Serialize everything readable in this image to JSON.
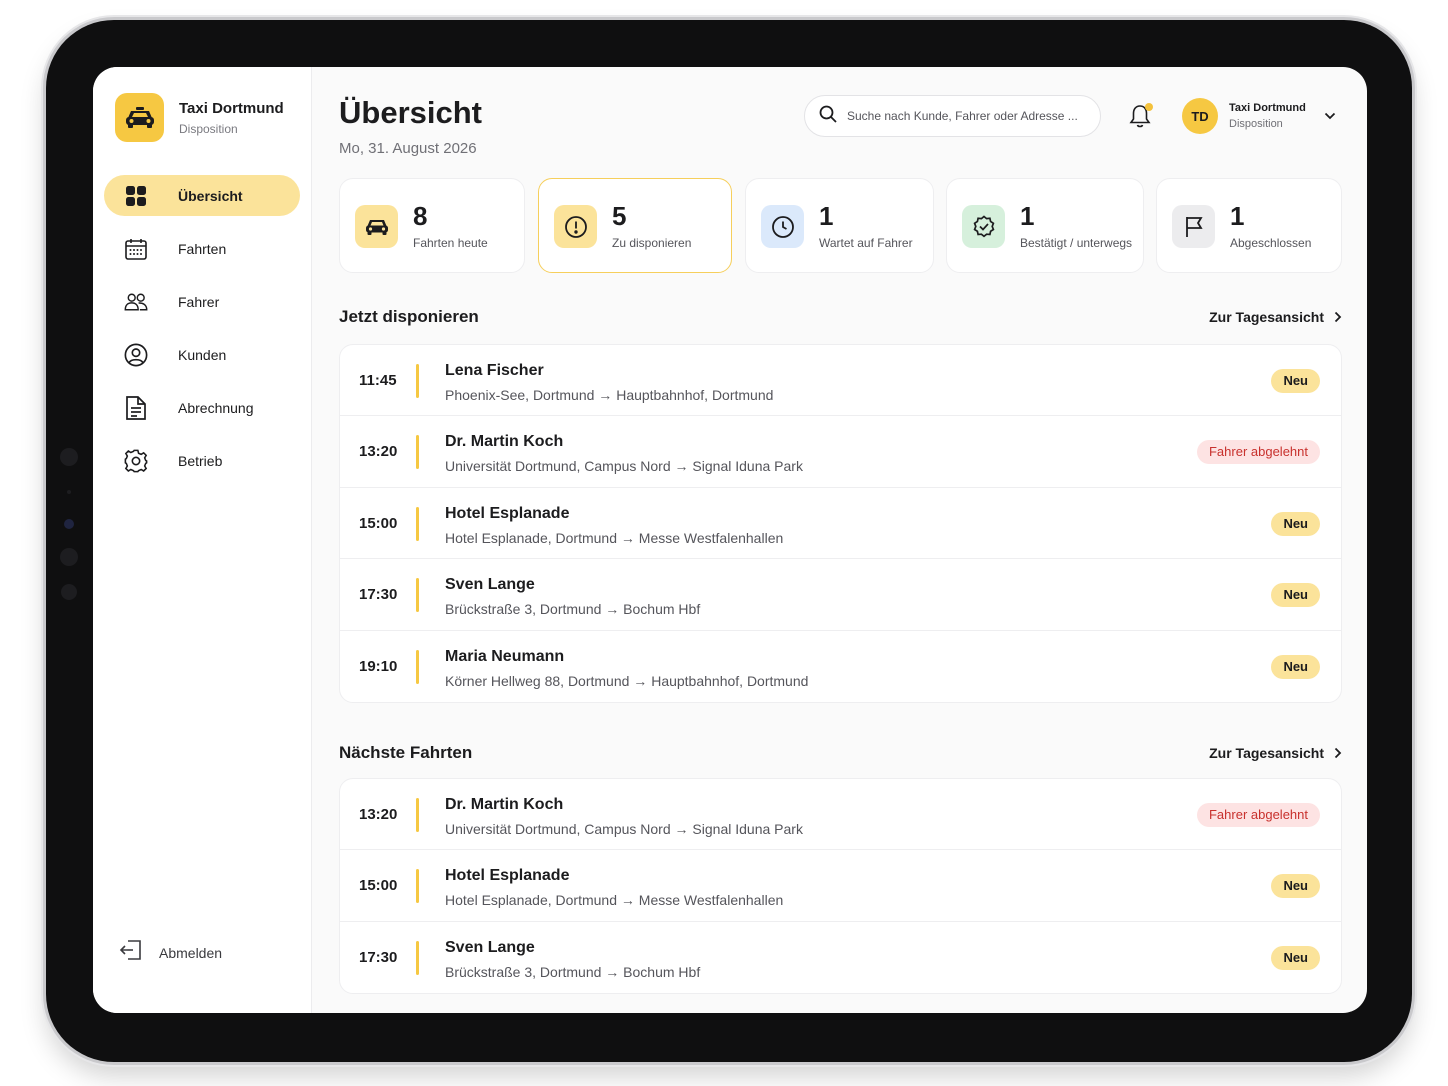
{
  "brand": {
    "name": "Taxi Dortmund",
    "subtitle": "Disposition",
    "icon": "taxi-car-icon",
    "accent": "#f6c842"
  },
  "nav": {
    "items": [
      {
        "label": "Übersicht",
        "icon": "grid-icon",
        "active": true
      },
      {
        "label": "Fahrten",
        "icon": "calendar-icon",
        "active": false
      },
      {
        "label": "Fahrer",
        "icon": "users-icon",
        "active": false
      },
      {
        "label": "Kunden",
        "icon": "user-circle-icon",
        "active": false
      },
      {
        "label": "Abrechnung",
        "icon": "document-icon",
        "active": false
      },
      {
        "label": "Betrieb",
        "icon": "gear-icon",
        "active": false
      }
    ],
    "logout_label": "Abmelden"
  },
  "header": {
    "title": "Übersicht",
    "date": "Mo, 31. August 2026",
    "search_placeholder": "Suche nach Kunde, Fahrer oder Adresse ...",
    "notification_indicator": true,
    "profile": {
      "initials": "TD",
      "name": "Taxi Dortmund",
      "role": "Disposition"
    }
  },
  "stats": [
    {
      "value": "8",
      "label": "Fahrten heute",
      "icon": "car-icon",
      "color": "#fbe39a"
    },
    {
      "value": "5",
      "label": "Zu disponieren",
      "icon": "alert-circle-icon",
      "color": "#fbe39a",
      "active": true
    },
    {
      "value": "1",
      "label": "Wartet auf Fahrer",
      "icon": "clock-icon",
      "color": "#dbe9fb"
    },
    {
      "value": "1",
      "label": "Bestätigt / unterwegs",
      "icon": "badge-check-icon",
      "color": "#d6f0dc"
    },
    {
      "value": "1",
      "label": "Abgeschlossen",
      "icon": "flag-icon",
      "color": "#ececee"
    }
  ],
  "dispatch_now": {
    "title": "Jetzt disponieren",
    "link": "Zur Tagesansicht",
    "rows": [
      {
        "time": "11:45",
        "name": "Lena Fischer",
        "from": "Phoenix-See, Dortmund",
        "to": "Hauptbahnhof, Dortmund",
        "status": "Neu"
      },
      {
        "time": "13:20",
        "name": "Dr. Martin Koch",
        "from": "Universität Dortmund, Campus Nord",
        "to": "Signal Iduna Park",
        "status": "Fahrer abgelehnt"
      },
      {
        "time": "15:00",
        "name": "Hotel Esplanade",
        "from": "Hotel Esplanade, Dortmund",
        "to": "Messe Westfalenhallen",
        "status": "Neu"
      },
      {
        "time": "17:30",
        "name": "Sven Lange",
        "from": "Brückstraße 3, Dortmund",
        "to": "Bochum Hbf",
        "status": "Neu"
      },
      {
        "time": "19:10",
        "name": "Maria Neumann",
        "from": "Körner Hellweg 88, Dortmund",
        "to": "Hauptbahnhof, Dortmund",
        "status": "Neu"
      }
    ]
  },
  "next_trips": {
    "title": "Nächste Fahrten",
    "link": "Zur Tagesansicht",
    "rows": [
      {
        "time": "13:20",
        "name": "Dr. Martin Koch",
        "from": "Universität Dortmund, Campus Nord",
        "to": "Signal Iduna Park",
        "status": "Fahrer abgelehnt"
      },
      {
        "time": "15:00",
        "name": "Hotel Esplanade",
        "from": "Hotel Esplanade, Dortmund",
        "to": "Messe Westfalenhallen",
        "status": "Neu"
      },
      {
        "time": "17:30",
        "name": "Sven Lange",
        "from": "Brückstraße 3, Dortmund",
        "to": "Bochum Hbf",
        "status": "Neu"
      }
    ]
  },
  "status_colors": {
    "Neu": "#fbe39a",
    "Fahrer abgelehnt": "#fde3e3"
  }
}
